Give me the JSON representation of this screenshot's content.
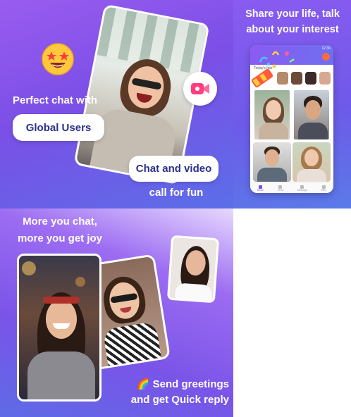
{
  "panel1": {
    "headline": "Perfect chat with",
    "badge_global": "Global Users",
    "badge_video": "Chat and video",
    "subline": "call for fun"
  },
  "panel2": {
    "headline_line1": "Share your life, talk",
    "headline_line2": "about your interest",
    "phone": {
      "status_time": "12:30",
      "section_label": "Today's fate",
      "nav_items": [
        "Home",
        "Show",
        "Message",
        "Mine"
      ]
    }
  },
  "panel3": {
    "headline_line1": "More you chat,",
    "headline_line2": "more you get joy",
    "footer_line1": "🌈 Send greetings",
    "footer_line2": "and get Quick reply"
  },
  "colors": {
    "brand_purple": "#7b4fe6",
    "badge_text": "#2d2f8f",
    "accent_pink": "#ff4f8b"
  },
  "icons": [
    "star-struck-emoji-icon",
    "video-camera-icon",
    "party-popper-icon",
    "rainbow-icon",
    "home-icon",
    "show-icon",
    "message-icon",
    "mine-icon"
  ]
}
